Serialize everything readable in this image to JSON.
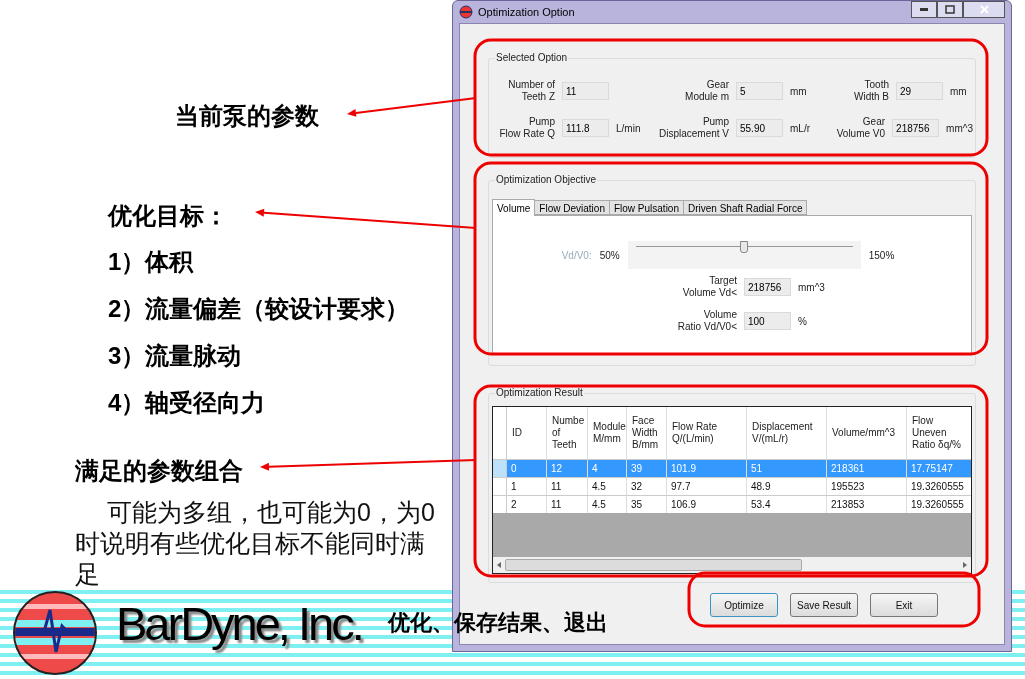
{
  "slide": {
    "annotations": [
      {
        "kind": "heading",
        "text": "当前泵的参数"
      },
      {
        "kind": "heading",
        "text": "优化目标："
      },
      {
        "kind": "item",
        "text": "1）体积"
      },
      {
        "kind": "item",
        "text": "2）流量偏差（较设计要求）"
      },
      {
        "kind": "item",
        "text": "3）流量脉动"
      },
      {
        "kind": "item",
        "text": "4）轴受径向力"
      },
      {
        "kind": "heading",
        "text": "满足的参数组合"
      },
      {
        "kind": "note",
        "text": "可能为多组，也可能为0，为0时说明有些优化目标不能同时满足"
      }
    ],
    "logo_text": "BarDyne, Inc.",
    "caption": "优化、保存结果、退出"
  },
  "window": {
    "title": "Optimization Option",
    "selected_option": {
      "title": "Selected Option",
      "fields": [
        {
          "label": "Number of\nTeeth Z",
          "value": "11"
        },
        {
          "label": "Gear\nModule m",
          "value": "5",
          "unit": "mm"
        },
        {
          "label": "Tooth\nWidth B",
          "value": "29",
          "unit": "mm"
        },
        {
          "label": "Pump\nFlow Rate Q",
          "value": "111.8",
          "unit": "L/min"
        },
        {
          "label": "Pump\nDisplacement V",
          "value": "55.90",
          "unit": "mL/r"
        },
        {
          "label": "Gear\nVolume V0",
          "value": "218756",
          "unit": "mm^3"
        }
      ]
    },
    "objective": {
      "title": "Optimization Objective",
      "tabs": [
        {
          "label": "Volume",
          "selected": true
        },
        {
          "label": "Flow Deviation",
          "selected": false
        },
        {
          "label": "Flow Pulsation",
          "selected": false
        },
        {
          "label": "Driven Shaft Radial Force",
          "selected": false
        }
      ],
      "slider": {
        "label": "Vd/V0:",
        "min_label": "50%",
        "max_label": "150%",
        "level": 0.5
      },
      "fields": [
        {
          "label": "Target\nVolume Vd<",
          "value": "218756",
          "unit": "mm^3"
        },
        {
          "label": "Volume\nRatio Vd/V0<",
          "value": "100",
          "unit": "%"
        }
      ]
    },
    "result": {
      "title": "Optimization Result",
      "columns": [
        "ID",
        "Numbe\nof\nTeeth",
        "Module\nM/mm",
        "Face\nWidth\nB/mm",
        "Flow Rate\nQ/(L/min)",
        "Displacement\nV/(mL/r)",
        "Volume/mm^3",
        "Flow\nUneven\nRatio δq/%"
      ],
      "rows": [
        {
          "selected": true,
          "cells": [
            "0",
            "12",
            "4",
            "39",
            "101.9",
            "51",
            "218361",
            "17.75147"
          ]
        },
        {
          "selected": false,
          "cells": [
            "1",
            "11",
            "4.5",
            "32",
            "97.7",
            "48.9",
            "195523",
            "19.3260555"
          ]
        },
        {
          "selected": false,
          "cells": [
            "2",
            "11",
            "4.5",
            "35",
            "106.9",
            "53.4",
            "213853",
            "19.3260555"
          ]
        }
      ]
    },
    "buttons": [
      {
        "label": "Optimize",
        "focused": true
      },
      {
        "label": "Save Result",
        "focused": false
      },
      {
        "label": "Exit",
        "focused": false
      }
    ]
  }
}
